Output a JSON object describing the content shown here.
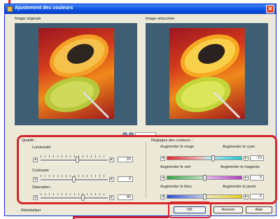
{
  "window": {
    "title": "Ajustement des couleurs",
    "close_glyph": "✕"
  },
  "preview": {
    "original_label": "Image originale",
    "corrected_label": "Image retouchée",
    "zoom_value": ""
  },
  "quality": {
    "title": "Qualité :",
    "sliders": [
      {
        "label": "Luminosité",
        "value": "20"
      },
      {
        "label": "Contraste",
        "value": "0"
      },
      {
        "label": "Saturation :",
        "value": "40"
      }
    ]
  },
  "color_balance": {
    "title": "Réglages des couleurs :",
    "rows": [
      {
        "left": "Augmenter le rouge",
        "right": "Augmenter le cyan",
        "value": "-13"
      },
      {
        "left": "Augmenter le vert",
        "right": "Augmenter le magenta",
        "value": "0"
      },
      {
        "left": "Augmenter le bleu",
        "right": "Augmenter le jaune",
        "value": "0"
      }
    ]
  },
  "footer": {
    "reset_label": "Réinitialiser",
    "ok_label": "OK",
    "cancel_label": "Annuler",
    "help_label": "Aide"
  },
  "colors": {
    "annotation": "#d8232a",
    "titlebar": "#0a4ee0",
    "preview_bg": "#3e5f73"
  },
  "icons": [
    "app-icon",
    "close-icon",
    "zoom-in-icon",
    "zoom-out-icon",
    "left-arrow-icon",
    "right-arrow-icon"
  ]
}
